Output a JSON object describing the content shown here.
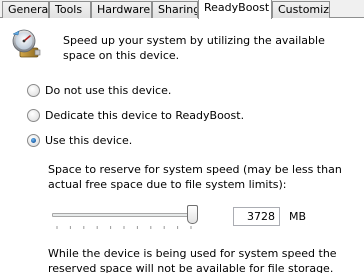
{
  "tabs": [
    {
      "label": "General"
    },
    {
      "label": "Tools"
    },
    {
      "label": "Hardware"
    },
    {
      "label": "Sharing"
    },
    {
      "label": "ReadyBoost"
    },
    {
      "label": "Customize"
    }
  ],
  "active_tab": "ReadyBoost",
  "header": {
    "description": "Speed up your system by utilizing the available space on this device."
  },
  "options": [
    {
      "label": "Do not use this device.",
      "checked": false
    },
    {
      "label": "Dedicate this device to ReadyBoost.",
      "checked": false
    },
    {
      "label": "Use this device.",
      "checked": true
    }
  ],
  "reserve": {
    "label": "Space to reserve for system speed (may be less than actual free space due to file system limits):",
    "value": "3728",
    "unit": "MB",
    "slider_fraction": 0.98
  },
  "note": "While the device is being used for system speed the reserved space will not be available for file storage.",
  "colors": {
    "tab_border": "#8e8f8f",
    "radio_dot": "#1c5fa8"
  }
}
